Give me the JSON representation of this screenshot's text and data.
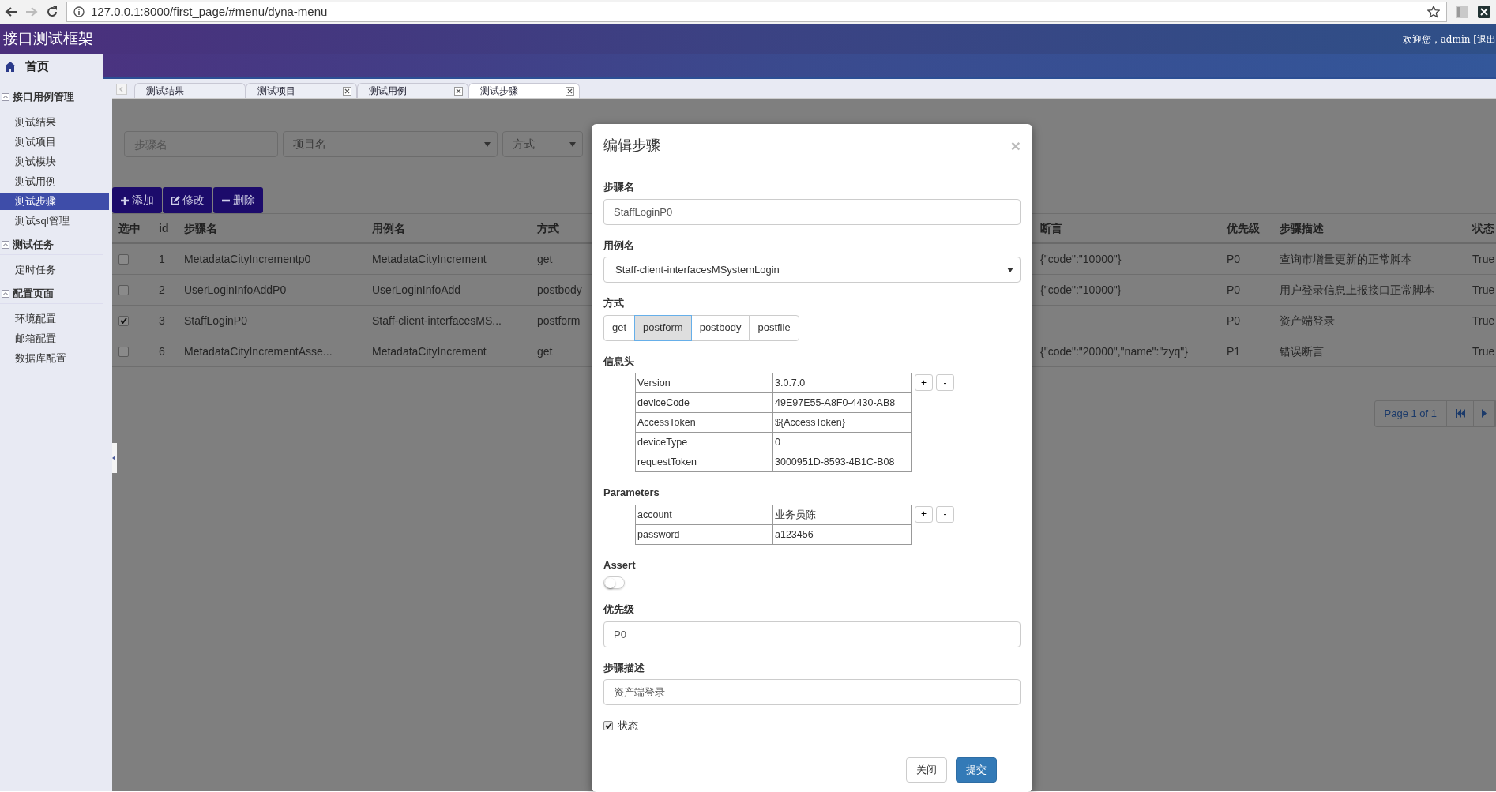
{
  "browser": {
    "url": "127.0.0.1:8000/first_page/#menu/dyna-menu"
  },
  "header": {
    "title": "接口测试框架",
    "user_text": "欢迎您，admin [退出"
  },
  "sidebar": {
    "home": "首页",
    "groups": [
      {
        "label": "接口用例管理",
        "expanded": true,
        "items": [
          {
            "label": "测试结果",
            "selected": false
          },
          {
            "label": "测试项目",
            "selected": false
          },
          {
            "label": "测试模块",
            "selected": false
          },
          {
            "label": "测试用例",
            "selected": false
          },
          {
            "label": "测试步骤",
            "selected": true
          },
          {
            "label": "测试sql管理",
            "selected": false
          }
        ]
      },
      {
        "label": "测试任务",
        "expanded": true,
        "items": [
          {
            "label": "定时任务",
            "selected": false
          }
        ]
      },
      {
        "label": "配置页面",
        "expanded": true,
        "items": [
          {
            "label": "环境配置",
            "selected": false
          },
          {
            "label": "邮箱配置",
            "selected": false
          },
          {
            "label": "数据库配置",
            "selected": false
          }
        ]
      }
    ]
  },
  "tabs": [
    {
      "label": "测试结果",
      "selected": false,
      "closable": false
    },
    {
      "label": "测试项目",
      "selected": false,
      "closable": true
    },
    {
      "label": "测试用例",
      "selected": false,
      "closable": true
    },
    {
      "label": "测试步骤",
      "selected": true,
      "closable": true
    }
  ],
  "filters": [
    {
      "kind": "input",
      "placeholder": "步骤名"
    },
    {
      "kind": "select",
      "value": "项目名"
    },
    {
      "kind": "select",
      "value": "方式"
    }
  ],
  "actions": [
    {
      "kind": "add",
      "label": "添加"
    },
    {
      "kind": "edit",
      "label": "修改"
    },
    {
      "kind": "delete",
      "label": "删除"
    }
  ],
  "table": {
    "columns": [
      "选中",
      "id",
      "步骤名",
      "用例名",
      "方式",
      "断言",
      "优先级",
      "步骤描述",
      "状态"
    ],
    "rows": [
      {
        "checked": false,
        "cells": [
          "",
          "1",
          "MetadataCityIncrementp0",
          "MetadataCityIncrement",
          "get",
          "{\"code\":\"10000\"}",
          "P0",
          "查询市增量更新的正常脚本",
          "True"
        ]
      },
      {
        "checked": false,
        "cells": [
          "",
          "2",
          "UserLoginInfoAddP0",
          "UserLoginInfoAdd",
          "postbody",
          "{\"code\":\"10000\"}",
          "P0",
          "用户登录信息上报接口正常脚本",
          "True"
        ]
      },
      {
        "checked": true,
        "cells": [
          "",
          "3",
          "StaffLoginP0",
          "Staff-client-interfacesMS...",
          "postform",
          null,
          "P0",
          "资产端登录",
          "True"
        ]
      },
      {
        "checked": false,
        "cells": [
          "",
          "6",
          "MetadataCityIncrementAsse...",
          "MetadataCityIncrement",
          "get",
          "{\"code\":\"20000\",\"name\":\"zyq\"}",
          "P1",
          "错误断言",
          "True"
        ]
      }
    ]
  },
  "pagination": {
    "text": "Page 1 of 1"
  },
  "modal": {
    "title": "编辑步骤",
    "close": "×",
    "step_name": {
      "label": "步骤名",
      "value": "StaffLoginP0"
    },
    "case_name": {
      "label": "用例名",
      "value": "Staff-client-interfacesMSystemLogin"
    },
    "method": {
      "label": "方式",
      "options": [
        {
          "label": "get",
          "selected": false
        },
        {
          "label": "postform",
          "selected": true
        },
        {
          "label": "postbody",
          "selected": false
        },
        {
          "label": "postfile",
          "selected": false
        }
      ]
    },
    "headers": {
      "label": "信息头",
      "add": "+",
      "remove": "-",
      "rows": [
        {
          "key": "Version",
          "value": "3.0.7.0"
        },
        {
          "key": "deviceCode",
          "value": "49E97E55-A8F0-4430-AB8"
        },
        {
          "key": "AccessToken",
          "value": "${AccessToken}"
        },
        {
          "key": "deviceType",
          "value": "0"
        },
        {
          "key": "requestToken",
          "value": "3000951D-8593-4B1C-B08"
        }
      ]
    },
    "parameters": {
      "label": "Parameters",
      "add": "+",
      "remove": "-",
      "rows": [
        {
          "key": "account",
          "value": "业务员陈"
        },
        {
          "key": "password",
          "value": "a123456"
        }
      ]
    },
    "assert": {
      "label": "Assert",
      "on": false
    },
    "priority": {
      "label": "优先级",
      "value": "P0"
    },
    "description": {
      "label": "步骤描述",
      "value": "资产端登录"
    },
    "status": {
      "label": "状态",
      "checked": true
    },
    "buttons": [
      {
        "kind": "secondary",
        "label": "关闭"
      },
      {
        "kind": "primary",
        "label": "提交"
      }
    ]
  }
}
